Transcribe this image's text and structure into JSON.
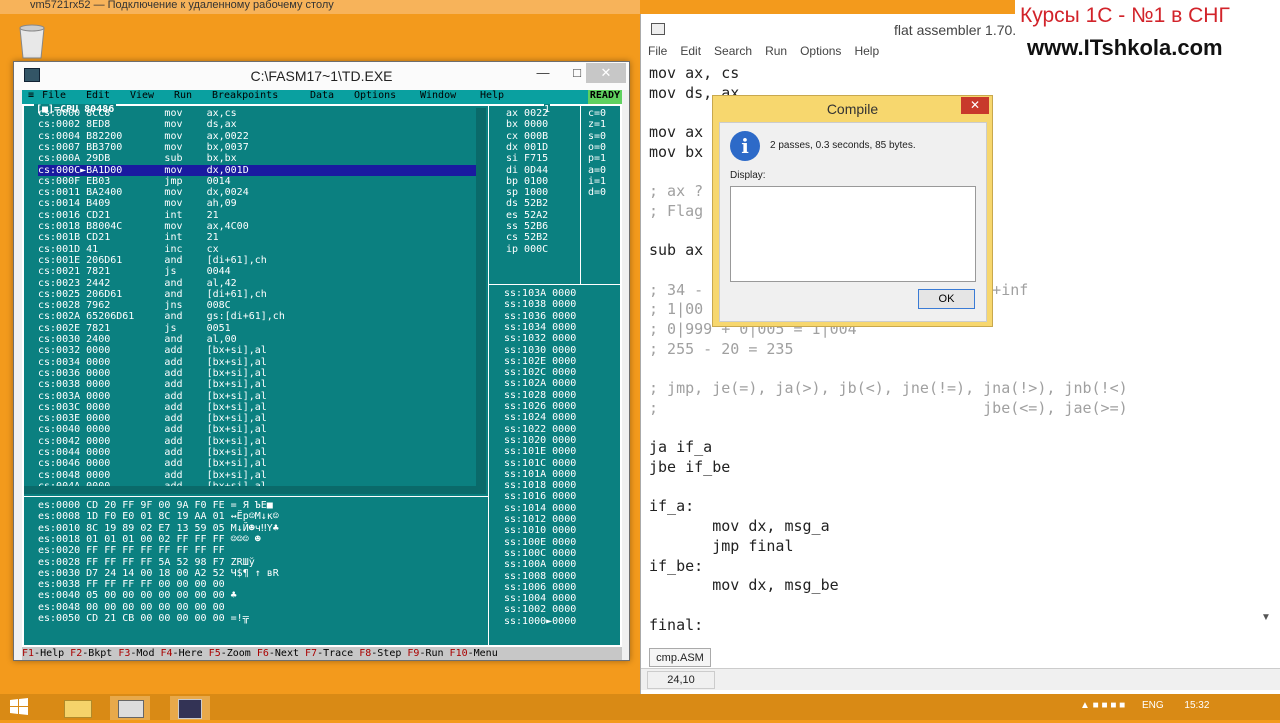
{
  "rdp": {
    "title": "vm5721rx52 — Подключение к удаленному рабочему столу"
  },
  "td": {
    "title": "C:\\FASM17~1\\TD.EXE",
    "menu": [
      "≡",
      "File",
      "Edit",
      "View",
      "Run",
      "Breakpoints",
      "Data",
      "Options",
      "Window",
      "Help"
    ],
    "status": "READY",
    "cpu_title": "[■]=CPU 80486",
    "panel_num": "1",
    "disasm": [
      "cs:0000 8CC8         mov    ax,cs",
      "cs:0002 8ED8         mov    ds,ax",
      "cs:0004 B82200       mov    ax,0022",
      "cs:0007 BB3700       mov    bx,0037",
      "cs:000A 29DB         sub    bx,bx",
      "cs:000C►BA1D00       mov    dx,001D",
      "cs:000F EB03         jmp    0014",
      "cs:0011 BA2400       mov    dx,0024",
      "cs:0014 B409         mov    ah,09",
      "cs:0016 CD21         int    21",
      "cs:0018 B8004C       mov    ax,4C00",
      "cs:001B CD21         int    21",
      "cs:001D 41           inc    cx",
      "cs:001E 206D61       and    [di+61],ch",
      "cs:0021 7821         js     0044",
      "cs:0023 2442         and    al,42",
      "cs:0025 206D61       and    [di+61],ch",
      "cs:0028 7962         jns    008C",
      "cs:002A 65206D61     and    gs:[di+61],ch",
      "cs:002E 7821         js     0051",
      "cs:0030 2400         and    al,00",
      "cs:0032 0000         add    [bx+si],al",
      "cs:0034 0000         add    [bx+si],al",
      "cs:0036 0000         add    [bx+si],al",
      "cs:0038 0000         add    [bx+si],al",
      "cs:003A 0000         add    [bx+si],al",
      "cs:003C 0000         add    [bx+si],al",
      "cs:003E 0000         add    [bx+si],al",
      "cs:0040 0000         add    [bx+si],al",
      "cs:0042 0000         add    [bx+si],al",
      "cs:0044 0000         add    [bx+si],al",
      "cs:0046 0000         add    [bx+si],al",
      "cs:0048 0000         add    [bx+si],al",
      "cs:004A 0000         add    [bx+si],al"
    ],
    "regs": [
      "ax 0022",
      "bx 0000",
      "cx 000B",
      "dx 001D",
      "si F715",
      "di 0D44",
      "bp 0100",
      "sp 1000",
      "ds 52B2",
      "es 52A2",
      "ss 52B6",
      "cs 52B2",
      "ip 000C"
    ],
    "flags": [
      "c=0",
      "z=1",
      "s=0",
      "o=0",
      "p=1",
      "a=0",
      "i=1",
      "d=0"
    ],
    "dump": [
      "es:0000 CD 20 FF 9F 00 9A F0 FE = Я ЪЁ■",
      "es:0008 1D F0 E0 01 8C 19 AA 01 ↔Ёр☺М↓к☺",
      "es:0010 8C 19 89 02 E7 13 59 05 М↓Й☻ч‼Y♣",
      "es:0018 01 01 01 00 02 FF FF FF ☺☺☺ ☻",
      "es:0020 FF FF FF FF FF FF FF FF",
      "es:0028 FF FF FF FF 5A 52 98 F7 ZRШў",
      "es:0030 D7 24 14 00 18 00 A2 52 Ч$¶ ↑ вR",
      "es:0038 FF FF FF FF 00 00 00 00",
      "es:0040 05 00 00 00 00 00 00 00 ♣",
      "es:0048 00 00 00 00 00 00 00 00",
      "es:0050 CD 21 CB 00 00 00 00 00 =!╦"
    ],
    "stack": [
      "ss:103A 0000",
      "ss:1038 0000",
      "ss:1036 0000",
      "ss:1034 0000",
      "ss:1032 0000",
      "ss:1030 0000",
      "ss:102E 0000",
      "ss:102C 0000",
      "ss:102A 0000",
      "ss:1028 0000",
      "ss:1026 0000",
      "ss:1024 0000",
      "ss:1022 0000",
      "ss:1020 0000",
      "ss:101E 0000",
      "ss:101C 0000",
      "ss:101A 0000",
      "ss:1018 0000",
      "ss:1016 0000",
      "ss:1014 0000",
      "ss:1012 0000",
      "ss:1010 0000",
      "ss:100E 0000",
      "ss:100C 0000",
      "ss:100A 0000",
      "ss:1008 0000",
      "ss:1006 0000",
      "ss:1004 0000",
      "ss:1002 0000",
      "ss:1000►0000"
    ],
    "fkeys": [
      {
        "k": "F1",
        "l": "-Help"
      },
      {
        "k": "F2",
        "l": "-Bkpt"
      },
      {
        "k": "F3",
        "l": "-Mod"
      },
      {
        "k": "F4",
        "l": "-Here"
      },
      {
        "k": "F5",
        "l": "-Zoom"
      },
      {
        "k": "F6",
        "l": "-Next"
      },
      {
        "k": "F7",
        "l": "-Trace"
      },
      {
        "k": "F8",
        "l": "-Step"
      },
      {
        "k": "F9",
        "l": "-Run"
      },
      {
        "k": "F10",
        "l": "-Menu"
      }
    ]
  },
  "fasm": {
    "title": "flat assembler 1.70.0",
    "menu": [
      "File",
      "Edit",
      "Search",
      "Run",
      "Options",
      "Help"
    ],
    "code": [
      {
        "t": "mov ax, cs",
        "c": false
      },
      {
        "t": "mov ds, ax",
        "c": false
      },
      {
        "t": "",
        "c": false
      },
      {
        "t": "mov ax",
        "c": false
      },
      {
        "t": "mov bx",
        "c": false
      },
      {
        "t": "",
        "c": false
      },
      {
        "t": "; ax ?",
        "c": true
      },
      {
        "t": "; Flag                           , 0",
        "c": true
      },
      {
        "t": "",
        "c": false
      },
      {
        "t": "sub ax",
        "c": false
      },
      {
        "t": "",
        "c": false
      },
      {
        "t": "; 34 -                          -inf, +inf",
        "c": true
      },
      {
        "t": "; 1|00",
        "c": true
      },
      {
        "t": "; 0|999 + 0|005 = 1|004",
        "c": true
      },
      {
        "t": "; 255 - 20 = 235",
        "c": true
      },
      {
        "t": "",
        "c": false
      },
      {
        "t": "; jmp, je(=), ja(>), jb(<), jne(!=), jna(!>), jnb(!<)",
        "c": true
      },
      {
        "t": ";                                    jbe(<=), jae(>=)",
        "c": true
      },
      {
        "t": "",
        "c": false
      },
      {
        "t": "ja if_a",
        "c": false
      },
      {
        "t": "jbe if_be",
        "c": false
      },
      {
        "t": "",
        "c": false
      },
      {
        "t": "if_a:",
        "c": false
      },
      {
        "t": "       mov dx, msg_a",
        "c": false
      },
      {
        "t": "       jmp final",
        "c": false
      },
      {
        "t": "if_be:",
        "c": false
      },
      {
        "t": "       mov dx, msg_be",
        "c": false
      },
      {
        "t": "",
        "c": false
      },
      {
        "t": "final:",
        "c": false
      }
    ],
    "tab": "cmp.ASM",
    "position": "24,10"
  },
  "dialog": {
    "title": "Compile",
    "message": "2 passes, 0.3 seconds, 85 bytes.",
    "display_label": "Display:",
    "ok": "OK"
  },
  "watermark": {
    "line1": "Курсы 1С - №1 в СНГ",
    "line2": "www.ITshkola.com"
  },
  "tray": {
    "lang": "ENG",
    "time": "15:32"
  }
}
